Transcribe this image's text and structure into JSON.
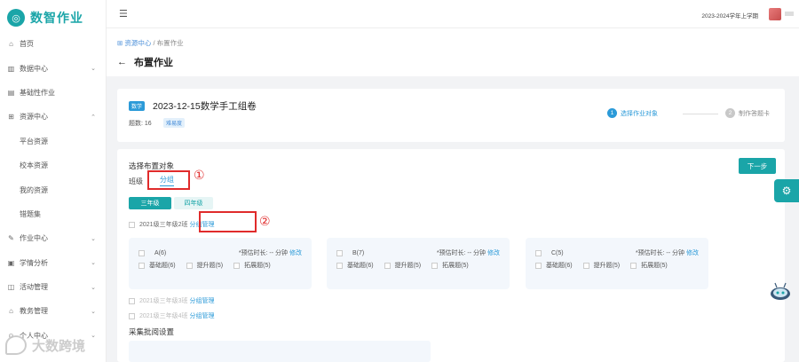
{
  "app": {
    "name": "数智作业",
    "logo_icon": "app-logo-icon"
  },
  "sidebar": {
    "items": [
      {
        "label": "首页",
        "icon": "home-icon",
        "chevron": ""
      },
      {
        "label": "数据中心",
        "icon": "chart-icon",
        "chevron": "⌄"
      },
      {
        "label": "基础性作业",
        "icon": "document-icon",
        "chevron": ""
      },
      {
        "label": "资源中心",
        "icon": "grid-icon",
        "chevron": "⌃"
      },
      {
        "label": "平台资源",
        "icon": "",
        "chevron": ""
      },
      {
        "label": "校本资源",
        "icon": "",
        "chevron": ""
      },
      {
        "label": "我的资源",
        "icon": "",
        "chevron": ""
      },
      {
        "label": "错题集",
        "icon": "",
        "chevron": ""
      },
      {
        "label": "作业中心",
        "icon": "edit-icon",
        "chevron": "⌄"
      },
      {
        "label": "学情分析",
        "icon": "analysis-icon",
        "chevron": "⌄"
      },
      {
        "label": "活动管理",
        "icon": "gift-icon",
        "chevron": "⌄"
      },
      {
        "label": "教务管理",
        "icon": "bank-icon",
        "chevron": "⌄"
      },
      {
        "label": "个人中心",
        "icon": "user-icon",
        "chevron": "⌄"
      }
    ]
  },
  "topbar": {
    "semester": "2023-2024学年上学期"
  },
  "breadcrumb": {
    "root": "资源中心",
    "separator": "/",
    "current": "布置作业"
  },
  "page": {
    "title": "布置作业"
  },
  "paper": {
    "subject_tag": "数学",
    "title": "2023-12-15数学手工组卷",
    "question_count": "题数: 16",
    "difficulty_tag": "难易度"
  },
  "steps": [
    {
      "num": "1",
      "label": "选择作业对象"
    },
    {
      "num": "2",
      "label": "制作答题卡"
    }
  ],
  "assign": {
    "section_title": "选择布置对象",
    "next_button": "下一步",
    "row_label": "班级",
    "group_tab": "分组",
    "annotation_1": "①",
    "annotation_2": "②",
    "grades": [
      "三年级",
      "四年级"
    ],
    "class_primary": {
      "name": "2021级三年级2班",
      "manage": "分组管理"
    },
    "groups": [
      {
        "name": "A(6)",
        "est": "*预估时长: -- 分钟",
        "edit": "修改",
        "opts": [
          "基础题(6)",
          "提升题(5)",
          "拓展题(5)"
        ]
      },
      {
        "name": "B(7)",
        "est": "*预估时长: -- 分钟",
        "edit": "修改",
        "opts": [
          "基础题(6)",
          "提升题(5)",
          "拓展题(5)"
        ]
      },
      {
        "name": "C(5)",
        "est": "*预估时长: -- 分钟",
        "edit": "修改",
        "opts": [
          "基础题(6)",
          "提升题(5)",
          "拓展题(5)"
        ]
      }
    ],
    "class_others": [
      {
        "name": "2021级三年级3班",
        "manage": "分组管理"
      },
      {
        "name": "2021级三年级4班",
        "manage": "分组管理"
      }
    ],
    "collect_title": "采集批阅设置"
  },
  "watermark": {
    "text": "大数跨境"
  }
}
